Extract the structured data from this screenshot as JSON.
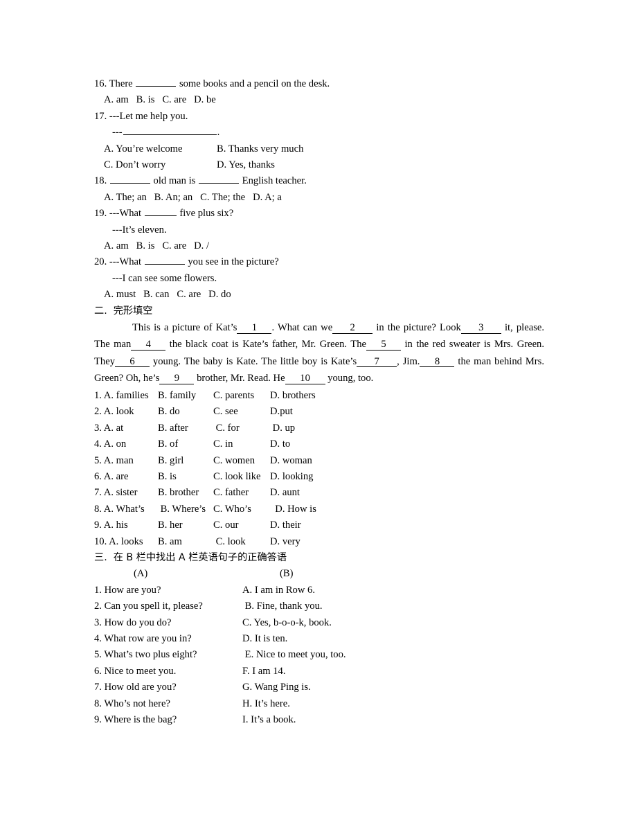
{
  "section_one": {
    "questions": [
      {
        "stem_pre": "16. There ",
        "stem_post": " some books and a pencil on the desk.",
        "options_line": "A. am   B. is   C. are   D. be"
      },
      {
        "stem": "17. ---Let me help you.",
        "answer_prompt": "---",
        "answer_suffix": ".",
        "option_a": "A. You’re welcome",
        "option_b": "B. Thanks very much",
        "option_c": "C. Don’t worry",
        "option_d": "D. Yes, thanks"
      },
      {
        "stem_pre": "18. ",
        "stem_mid": " old man is ",
        "stem_post": " English teacher.",
        "options_line": "A. The; an   B. An; an   C. The; the   D. A; a"
      },
      {
        "stem_pre": "19. ---What ",
        "stem_post": " five plus six?",
        "reply": "---It’s eleven.",
        "options_line": "A. am   B. is   C. are   D. /"
      },
      {
        "stem_pre": "20. ---What ",
        "stem_post": " you see in the picture?",
        "reply": "---I can see some flowers.",
        "options_line": "A. must   B. can   C. are   D. do"
      }
    ]
  },
  "section_two": {
    "heading": "二.  完形填空",
    "passage": {
      "t1": "This is a picture of Kat’s",
      "n1": "1",
      "t2": ". What can we",
      "n2": "2",
      "t3": " in the picture? Look",
      "n3": "3",
      "t4": " it, please. The man",
      "n4": "4",
      "t5": " the black coat is Kate’s father, Mr. Green. The",
      "n5": "5",
      "t6": " in the red sweater is Mrs. Green. They",
      "n6": "6",
      "t7": " young. The baby is Kate. The little boy is Kate’s",
      "n7": "7",
      "t8": ", Jim.",
      "n8": "8",
      "t9": " the man behind Mrs. Green? Oh, he’s",
      "n9": "9",
      "t10": " brother, Mr. Read. He",
      "n10": "10",
      "t11": " young, too."
    },
    "options": [
      {
        "num_a": "1. A. families",
        "b": "B. family",
        "c": "C. parents",
        "d": "D. brothers"
      },
      {
        "num_a": "2. A. look",
        "b": "B. do",
        "c": "C. see",
        "d": "D.put"
      },
      {
        "num_a": "3. A. at",
        "b": "B. after",
        "c": " C. for",
        "d": " D. up"
      },
      {
        "num_a": "4. A. on",
        "b": "B. of",
        "c": "C. in",
        "d": "D. to"
      },
      {
        "num_a": "5. A. man",
        "b": "B. girl",
        "c": "C. women",
        "d": "D. woman"
      },
      {
        "num_a": "6. A. are",
        "b": "B. is",
        "c": "C. look like",
        "d": "D. looking"
      },
      {
        "num_a": "7. A. sister",
        "b": "B. brother",
        "c": "C. father",
        "d": "D. aunt"
      },
      {
        "num_a": "8. A. What’s",
        "b": " B. Where’s",
        "c": "C. Who’s",
        "d": "  D. How is"
      },
      {
        "num_a": "9. A. his",
        "b": "B. her",
        "c": "C. our",
        "d": "D. their"
      },
      {
        "num_a": "10. A. looks",
        "b": "B. am",
        "c": " C. look",
        "d": "D. very"
      }
    ]
  },
  "section_three": {
    "heading": "三.  在 B 栏中找出 A 栏英语句子的正确答语",
    "col_a_header": "(A)",
    "col_b_header": "(B)",
    "rows": [
      {
        "a": "1. How are you?",
        "b": "A. I am in Row 6."
      },
      {
        "a": "2. Can you spell it, please?",
        "b": " B. Fine, thank you."
      },
      {
        "a": "3. How do you do?",
        "b": "C. Yes, b-o-o-k, book."
      },
      {
        "a": "4. What row are you in?",
        "b": "D. It is ten."
      },
      {
        "a": "5. What’s two plus eight?",
        "b": " E. Nice to meet you, too."
      },
      {
        "a": "6. Nice to meet you.",
        "b": "F. I am 14."
      },
      {
        "a": "7. How old are you?",
        "b": "G. Wang Ping is."
      },
      {
        "a": "8. Who’s not here?",
        "b": "H. It’s here."
      },
      {
        "a": "9. Where is the bag?",
        "b": "I. It’s a book."
      }
    ]
  }
}
